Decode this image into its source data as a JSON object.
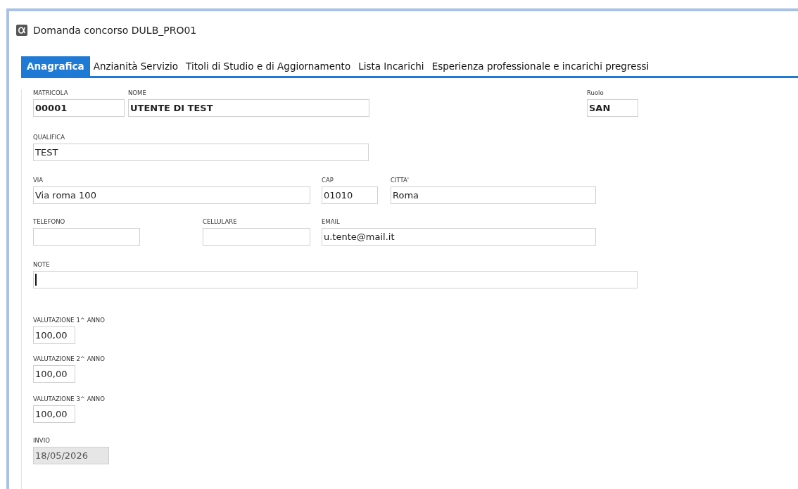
{
  "window": {
    "title": "Domanda concorso DULB_PRO01"
  },
  "tabs": [
    {
      "label": "Anagrafica",
      "selected": true
    },
    {
      "label": "Anzianità Servizio",
      "selected": false
    },
    {
      "label": "Titoli di Studio e di Aggiornamento",
      "selected": false
    },
    {
      "label": "Lista Incarichi",
      "selected": false
    },
    {
      "label": "Esperienza professionale e incarichi pregressi",
      "selected": false
    }
  ],
  "rows": [
    [
      {
        "label": "MATRICOLA",
        "value": "00001",
        "bold": true
      },
      {
        "label": "NOME",
        "value": "UTENTE DI TEST",
        "bold": true
      },
      {
        "label": "Ruolo",
        "value": "SAN",
        "bold": true
      }
    ],
    [
      {
        "label": "QUALIFICA",
        "value": "TEST"
      }
    ],
    [
      {
        "label": "VIA",
        "value": "Via roma 100"
      },
      {
        "label": "CAP",
        "value": "01010"
      },
      {
        "label": "CITTA'",
        "value": "Roma"
      }
    ],
    [
      {
        "label": "TELEFONO"
      },
      {
        "label": "CELLULARE"
      },
      {
        "label": "EMAIL",
        "value": "u.tente@mail.it"
      }
    ],
    [
      {
        "label": "NOTE",
        "focused": true
      }
    ],
    [
      {
        "label": "VALUTAZIONE 1^ ANNO",
        "value": "100,00"
      }
    ],
    [
      {
        "label": "VALUTAZIONE 2^ ANNO",
        "value": "100,00"
      }
    ],
    [
      {
        "label": "VALUTAZIONE 3^ ANNO",
        "value": "100,00"
      }
    ],
    [
      {
        "label": "INVIO",
        "value": "18/05/2026",
        "disabled": true
      }
    ]
  ]
}
